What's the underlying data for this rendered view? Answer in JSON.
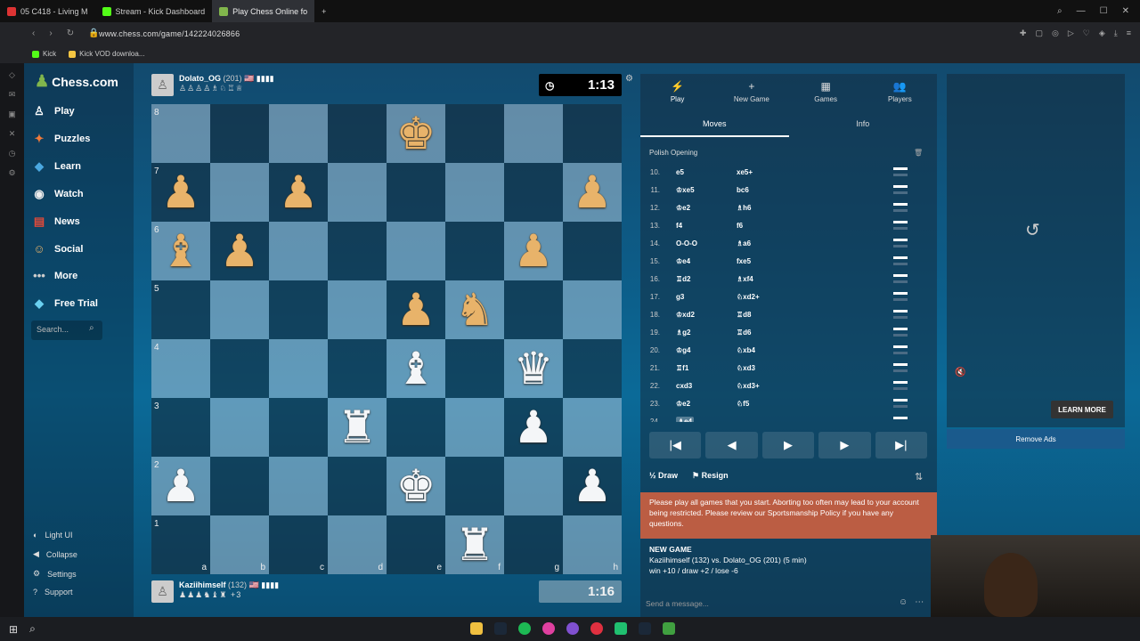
{
  "browser": {
    "tabs": [
      {
        "label": "05 C418 - Living M",
        "color": "#d33",
        "active": false
      },
      {
        "label": "Stream - Kick Dashboard",
        "color": "#53fc18",
        "active": false
      },
      {
        "label": "Play Chess Online fo",
        "color": "#81b64c",
        "active": true
      }
    ],
    "new_tab": "+",
    "url": "www.chess.com/game/142224026866",
    "bookmarks": [
      "Kick",
      "Kick VOD downloa..."
    ]
  },
  "sidebar": {
    "logo": "Chess.com",
    "nav": [
      {
        "label": "Play",
        "icon": "play-icon"
      },
      {
        "label": "Puzzles",
        "icon": "puzzle-icon"
      },
      {
        "label": "Learn",
        "icon": "learn-icon"
      },
      {
        "label": "Watch",
        "icon": "watch-icon"
      },
      {
        "label": "News",
        "icon": "news-icon"
      },
      {
        "label": "Social",
        "icon": "social-icon"
      },
      {
        "label": "More",
        "icon": "more-icon"
      },
      {
        "label": "Free Trial",
        "icon": "diamond-icon"
      }
    ],
    "search_placeholder": "Search...",
    "bottom": [
      "Light UI",
      "Collapse",
      "Settings",
      "Support"
    ]
  },
  "game": {
    "top_player": {
      "name": "Dolato_OG",
      "rating": "(201)",
      "flag": "🇺🇸",
      "badge": "▮▮▮▮",
      "captured": "♙♙♙♙♗♘♖♕"
    },
    "bottom_player": {
      "name": "Kaziihimself",
      "rating": "(132)",
      "flag": "🇺🇸",
      "badge": "▮▮▮▮",
      "captured": "♟♟♟♞♝♜",
      "diff": "+3"
    },
    "top_clock": "1:13",
    "bottom_clock": "1:16",
    "ranks": [
      "8",
      "7",
      "6",
      "5",
      "4",
      "3",
      "2",
      "1"
    ],
    "files": [
      "a",
      "b",
      "c",
      "d",
      "e",
      "f",
      "g",
      "h"
    ],
    "board": [
      [
        "",
        "",
        "",
        "",
        "bk",
        "",
        "",
        ""
      ],
      [
        "bp",
        "",
        "bp",
        "",
        "",
        "",
        "",
        "bp"
      ],
      [
        "bb",
        "bp",
        "",
        "",
        "",
        "",
        "bp",
        ""
      ],
      [
        "",
        "",
        "",
        "",
        "bp",
        "bn",
        "",
        ""
      ],
      [
        "",
        "",
        "",
        "",
        "wb",
        "",
        "wq",
        ""
      ],
      [
        "",
        "",
        "",
        "wr",
        "",
        "",
        "wp",
        ""
      ],
      [
        "wp",
        "",
        "",
        "",
        "wk",
        "",
        "",
        "wp"
      ],
      [
        "",
        "",
        "",
        "",
        "",
        "wr",
        "",
        ""
      ]
    ]
  },
  "panel": {
    "tabs": [
      {
        "label": "Play",
        "icon": "⚡"
      },
      {
        "label": "New Game",
        "icon": "+"
      },
      {
        "label": "Games",
        "icon": "▦"
      },
      {
        "label": "Players",
        "icon": "👥"
      }
    ],
    "subtabs": [
      "Moves",
      "Info"
    ],
    "opening": "Polish Opening",
    "moves": [
      {
        "n": "10.",
        "w": "e5",
        "b": "xe5+"
      },
      {
        "n": "11.",
        "w": "♔xe5",
        "b": "bc6"
      },
      {
        "n": "12.",
        "w": "♔e2",
        "b": "♗h6"
      },
      {
        "n": "13.",
        "w": "f4",
        "b": "f6"
      },
      {
        "n": "14.",
        "w": "O-O-O",
        "b": "♗a6"
      },
      {
        "n": "15.",
        "w": "♔e4",
        "b": "fxe5"
      },
      {
        "n": "16.",
        "w": "♖d2",
        "b": "♗xf4"
      },
      {
        "n": "17.",
        "w": "g3",
        "b": "♘xd2+"
      },
      {
        "n": "18.",
        "w": "♔xd2",
        "b": "♖d8"
      },
      {
        "n": "19.",
        "w": "♗g2",
        "b": "♖d6"
      },
      {
        "n": "20.",
        "w": "♔g4",
        "b": "♘xb4"
      },
      {
        "n": "21.",
        "w": "♖f1",
        "b": "♘xd3"
      },
      {
        "n": "22.",
        "w": "cxd3",
        "b": "♘xd3+"
      },
      {
        "n": "23.",
        "w": "♔e2",
        "b": "♘f5"
      },
      {
        "n": "24.",
        "w": "♗e4",
        "b": ""
      }
    ],
    "controls": [
      "|◀",
      "◀",
      "▶",
      "▶",
      "▶|"
    ],
    "draw": "Draw",
    "resign": "Resign",
    "notice": "Please play all games that you start. Aborting too often may lead to your account being restricted. Please review our Sportsmanship Policy if you have any questions.",
    "new_game_title": "NEW GAME",
    "new_game_line1": "Kaziihimself (132) vs. Dolato_OG (201) (5 min)",
    "new_game_line2": "win +10 / draw +2 / lose -6",
    "message_placeholder": "Send a message..."
  },
  "ad": {
    "learn_more": "LEARN MORE",
    "remove_ads": "Remove Ads"
  }
}
